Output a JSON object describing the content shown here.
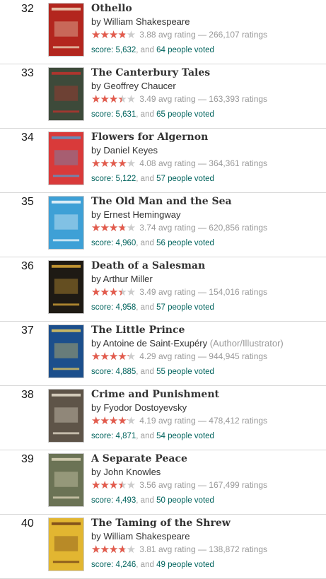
{
  "books": [
    {
      "rank": "32",
      "title": "Othello",
      "author": "William Shakespeare",
      "role": "",
      "rating_fraction": 0.776,
      "rating_text": "3.88 avg rating — 266,107 ratings",
      "score": "score: 5,632",
      "and": ", and",
      "votes": "64 people voted",
      "cover": {
        "bg": "#b3261e",
        "accent": "#f1e4c8"
      }
    },
    {
      "rank": "33",
      "title": "The Canterbury Tales",
      "author": "Geoffrey Chaucer",
      "role": "",
      "rating_fraction": 0.698,
      "rating_text": "3.49 avg rating — 163,393 ratings",
      "score": "score: 5,631",
      "and": ", and",
      "votes": "65 people voted",
      "cover": {
        "bg": "#3d4a3a",
        "accent": "#c9302c"
      }
    },
    {
      "rank": "34",
      "title": "Flowers for Algernon",
      "author": "Daniel Keyes",
      "role": "",
      "rating_fraction": 0.816,
      "rating_text": "4.08 avg rating — 364,361 ratings",
      "score": "score: 5,122",
      "and": ", and",
      "votes": "57 people voted",
      "cover": {
        "bg": "#d93a3a",
        "accent": "#4aa3d9"
      }
    },
    {
      "rank": "35",
      "title": "The Old Man and the Sea",
      "author": "Ernest Hemingway",
      "role": "",
      "rating_fraction": 0.748,
      "rating_text": "3.74 avg rating — 620,856 ratings",
      "score": "score: 4,960",
      "and": ", and",
      "votes": "56 people voted",
      "cover": {
        "bg": "#3ea0d6",
        "accent": "#ffffff"
      }
    },
    {
      "rank": "36",
      "title": "Death of a Salesman",
      "author": "Arthur Miller",
      "role": "",
      "rating_fraction": 0.698,
      "rating_text": "3.49 avg rating — 154,016 ratings",
      "score": "score: 4,958",
      "and": ", and",
      "votes": "57 people voted",
      "cover": {
        "bg": "#1e1a14",
        "accent": "#e8b23a"
      }
    },
    {
      "rank": "37",
      "title": "The Little Prince",
      "author": "Antoine de Saint-Exupéry",
      "role": "(Author/Illustrator)",
      "rating_fraction": 0.858,
      "rating_text": "4.29 avg rating — 944,945 ratings",
      "score": "score: 4,885",
      "and": ", and",
      "votes": "55 people voted",
      "cover": {
        "bg": "#1c4f8c",
        "accent": "#f3d05a"
      }
    },
    {
      "rank": "38",
      "title": "Crime and Punishment",
      "author": "Fyodor Dostoyevsky",
      "role": "",
      "rating_fraction": 0.838,
      "rating_text": "4.19 avg rating — 478,412 ratings",
      "score": "score: 4,871",
      "and": ", and",
      "votes": "54 people voted",
      "cover": {
        "bg": "#5e5448",
        "accent": "#efe7d6"
      }
    },
    {
      "rank": "39",
      "title": "A Separate Peace",
      "author": "John Knowles",
      "role": "",
      "rating_fraction": 0.712,
      "rating_text": "3.56 avg rating — 167,499 ratings",
      "score": "score: 4,493",
      "and": ", and",
      "votes": "50 people voted",
      "cover": {
        "bg": "#6b7355",
        "accent": "#e5dcc0"
      }
    },
    {
      "rank": "40",
      "title": "The Taming of the Shrew",
      "author": "William Shakespeare",
      "role": "",
      "rating_fraction": 0.762,
      "rating_text": "3.81 avg rating — 138,872 ratings",
      "score": "score: 4,246",
      "and": ", and",
      "votes": "49 people voted",
      "cover": {
        "bg": "#e2b631",
        "accent": "#6b3a16"
      }
    }
  ],
  "by_label": "by",
  "colors": {
    "star_filled": "#e35b4d",
    "star_empty": "#cccccc",
    "link_teal": "#00635d",
    "muted": "#999999"
  }
}
